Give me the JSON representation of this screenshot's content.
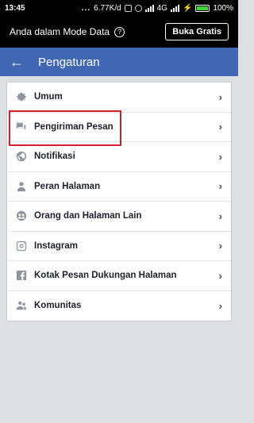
{
  "status_bar": {
    "time": "13:45",
    "dots": "...",
    "speed": "6.77K/d",
    "network": "4G",
    "battery": "100%",
    "colors": {
      "battery_fill": "#43d23f"
    }
  },
  "data_banner": {
    "text": "Anda dalam Mode Data",
    "help_glyph": "?",
    "button_label": "Buka Gratis"
  },
  "app_bar": {
    "title": "Pengaturan",
    "back_glyph": "←",
    "color": "#4267b2"
  },
  "settings": {
    "items": [
      {
        "label": "Umum",
        "icon": "gear-icon"
      },
      {
        "label": "Pengiriman Pesan",
        "icon": "chat-bubbles-icon"
      },
      {
        "label": "Notifikasi",
        "icon": "globe-icon"
      },
      {
        "label": "Peran Halaman",
        "icon": "person-icon"
      },
      {
        "label": "Orang dan Halaman Lain",
        "icon": "people-circle-icon"
      },
      {
        "label": "Instagram",
        "icon": "instagram-icon"
      },
      {
        "label": "Kotak Pesan Dukungan Halaman",
        "icon": "facebook-icon"
      },
      {
        "label": "Komunitas",
        "icon": "community-icon"
      }
    ],
    "chevron": "›",
    "highlight_color": "#d0202e"
  }
}
